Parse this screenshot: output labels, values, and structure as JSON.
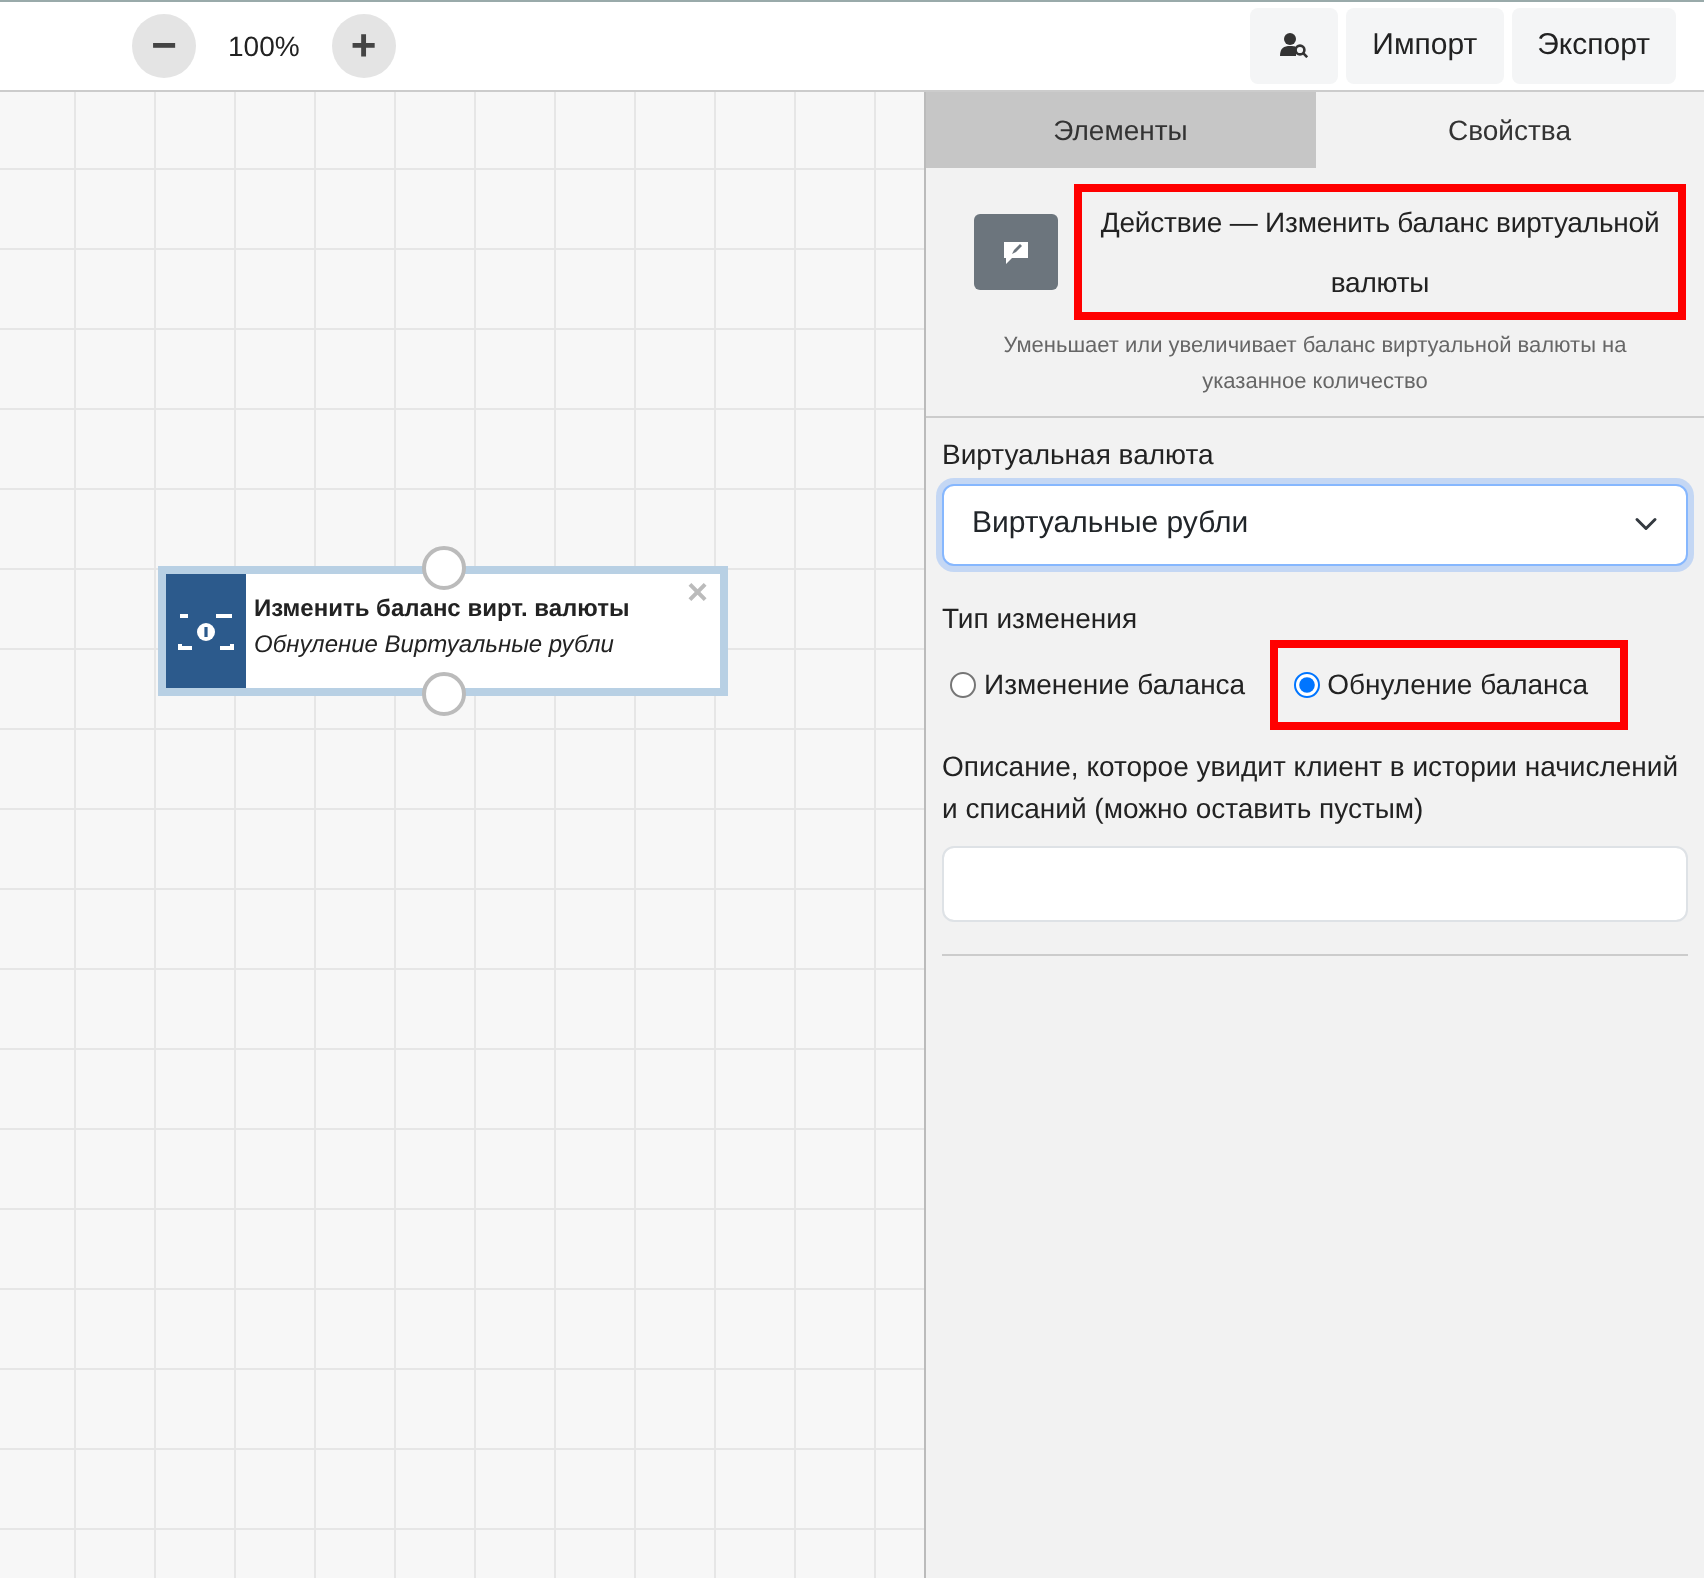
{
  "toolbar": {
    "zoom_out": "−",
    "zoom": "100%",
    "zoom_in": "+",
    "buttons": [
      {
        "kind": "icon"
      },
      {
        "kind": "text",
        "label": "Импорт"
      },
      {
        "kind": "text",
        "label": "Экспорт"
      }
    ]
  },
  "canvas": {
    "node": {
      "title": "Изменить баланс вирт. валюты",
      "subtitle": "Обнуление Виртуальные рубли",
      "close": "×",
      "selected": true
    }
  },
  "panel": {
    "tabs": [
      {
        "label": "Элементы",
        "selected": false
      },
      {
        "label": "Свойства",
        "selected": true
      }
    ],
    "heading": {
      "text": "Действие — Изменить баланс виртуальной валюты",
      "highlighted": true
    },
    "description": "Уменьшает или увеличивает баланс виртуальной валюты на указанное количество",
    "currency": {
      "label": "Виртуальная валюта",
      "value": "Виртуальные рубли"
    },
    "change_type": {
      "label": "Тип изменения",
      "options": [
        {
          "label": "Изменение баланса",
          "selected": false,
          "highlighted": false
        },
        {
          "label": "Обнуление баланса",
          "selected": true,
          "highlighted": true
        }
      ]
    },
    "comment": {
      "label": "Описание, которое увидит клиент в истории начислений и списаний (можно оставить пустым)"
    }
  }
}
